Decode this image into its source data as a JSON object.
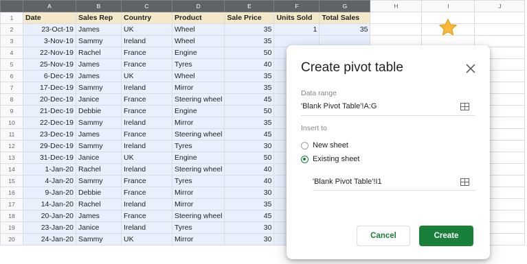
{
  "sheet": {
    "column_letters": [
      "A",
      "B",
      "C",
      "D",
      "E",
      "F",
      "G",
      "H",
      "I",
      "J"
    ],
    "header": [
      "Date",
      "Sales Rep",
      "Country",
      "Product",
      "Sale Price",
      "Units Sold",
      "Total Sales"
    ],
    "rows": [
      {
        "n": "2",
        "cells": [
          "23-Oct-19",
          "James",
          "UK",
          "Wheel",
          "35",
          "1",
          "35"
        ]
      },
      {
        "n": "3",
        "cells": [
          "3-Nov-19",
          "Sammy",
          "Ireland",
          "Wheel",
          "35",
          "",
          ""
        ]
      },
      {
        "n": "4",
        "cells": [
          "22-Nov-19",
          "Rachel",
          "France",
          "Engine",
          "50",
          "",
          ""
        ]
      },
      {
        "n": "5",
        "cells": [
          "25-Nov-19",
          "James",
          "France",
          "Tyres",
          "40",
          "",
          ""
        ]
      },
      {
        "n": "6",
        "cells": [
          "6-Dec-19",
          "James",
          "UK",
          "Wheel",
          "35",
          "",
          ""
        ]
      },
      {
        "n": "7",
        "cells": [
          "17-Dec-19",
          "Sammy",
          "Ireland",
          "Mirror",
          "35",
          "",
          ""
        ]
      },
      {
        "n": "8",
        "cells": [
          "20-Dec-19",
          "Janice",
          "France",
          "Steering wheel",
          "45",
          "",
          ""
        ]
      },
      {
        "n": "9",
        "cells": [
          "21-Dec-19",
          "Debbie",
          "France",
          "Engine",
          "50",
          "",
          ""
        ]
      },
      {
        "n": "10",
        "cells": [
          "22-Dec-19",
          "Sammy",
          "Ireland",
          "Mirror",
          "35",
          "",
          ""
        ]
      },
      {
        "n": "11",
        "cells": [
          "23-Dec-19",
          "James",
          "France",
          "Steering wheel",
          "45",
          "",
          ""
        ]
      },
      {
        "n": "12",
        "cells": [
          "29-Dec-19",
          "Sammy",
          "Ireland",
          "Tyres",
          "30",
          "",
          ""
        ]
      },
      {
        "n": "13",
        "cells": [
          "31-Dec-19",
          "Janice",
          "UK",
          "Engine",
          "50",
          "",
          ""
        ]
      },
      {
        "n": "14",
        "cells": [
          "1-Jan-20",
          "Rachel",
          "Ireland",
          "Steering wheel",
          "40",
          "",
          ""
        ]
      },
      {
        "n": "15",
        "cells": [
          "4-Jan-20",
          "Sammy",
          "France",
          "Tyres",
          "40",
          "",
          ""
        ]
      },
      {
        "n": "16",
        "cells": [
          "9-Jan-20",
          "Debbie",
          "France",
          "Mirror",
          "30",
          "",
          ""
        ]
      },
      {
        "n": "17",
        "cells": [
          "14-Jan-20",
          "Rachel",
          "Ireland",
          "Mirror",
          "35",
          "",
          ""
        ]
      },
      {
        "n": "18",
        "cells": [
          "20-Jan-20",
          "James",
          "France",
          "Steering wheel",
          "45",
          "",
          ""
        ]
      },
      {
        "n": "19",
        "cells": [
          "23-Jan-20",
          "Janice",
          "Ireland",
          "Tyres",
          "30",
          "",
          ""
        ]
      },
      {
        "n": "20",
        "cells": [
          "24-Jan-20",
          "Sammy",
          "UK",
          "Mirror",
          "30",
          "",
          ""
        ]
      }
    ]
  },
  "dialog": {
    "title": "Create pivot table",
    "data_range_label": "Data range",
    "data_range_value": "'Blank Pivot Table'!A:G",
    "insert_to_label": "Insert to",
    "option_new_sheet": "New sheet",
    "option_existing_sheet": "Existing sheet",
    "existing_sheet_value": "'Blank Pivot Table'!I1",
    "cancel_label": "Cancel",
    "create_label": "Create"
  },
  "colors": {
    "accent_green": "#188038",
    "selection_blue": "#e8f0fe",
    "header_tan": "#f3e9c8",
    "star_yellow": "#f6b93b"
  },
  "icons": [
    "star-icon",
    "close-icon",
    "grid-select-icon"
  ]
}
